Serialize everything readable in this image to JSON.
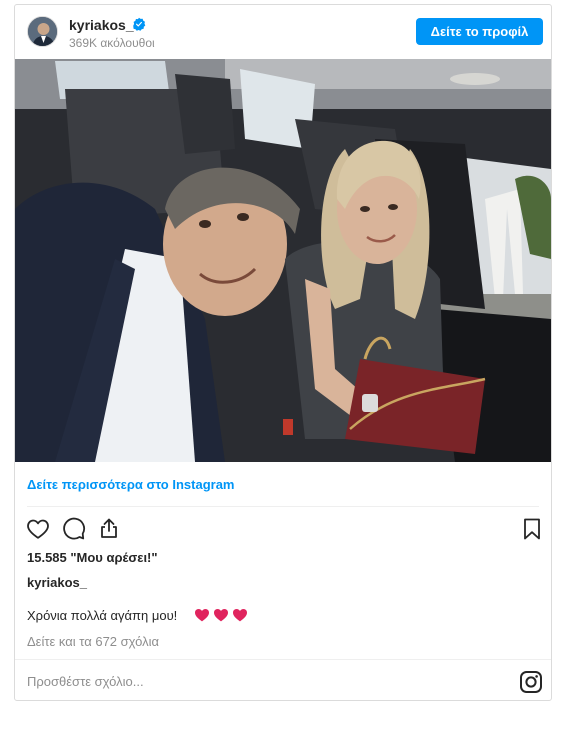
{
  "header": {
    "username": "kyriakos_",
    "followers": "369K ακόλουθοι",
    "profile_button": "Δείτε το προφίλ"
  },
  "photo_link": "Δείτε περισσότερα στο Instagram",
  "icons": {
    "like": "heart-outline-icon",
    "comment": "comment-bubble-icon",
    "share": "share-icon",
    "save": "bookmark-icon",
    "verified": "verified-badge-icon",
    "instagram": "instagram-logo-icon"
  },
  "stats": {
    "likes": "15.585 \"Μου αρέσει!\""
  },
  "post": {
    "author": "kyriakos_",
    "caption": "Χρόνια πολλά αγάπη μου!",
    "hearts": [
      "❤",
      "❤",
      "❤"
    ],
    "view_comments": "Δείτε και τα 672 σχόλια"
  },
  "comment": {
    "placeholder": "Προσθέστε σχόλιο..."
  },
  "colors": {
    "accent": "#0095f6",
    "heart_red": "#e0245e"
  }
}
